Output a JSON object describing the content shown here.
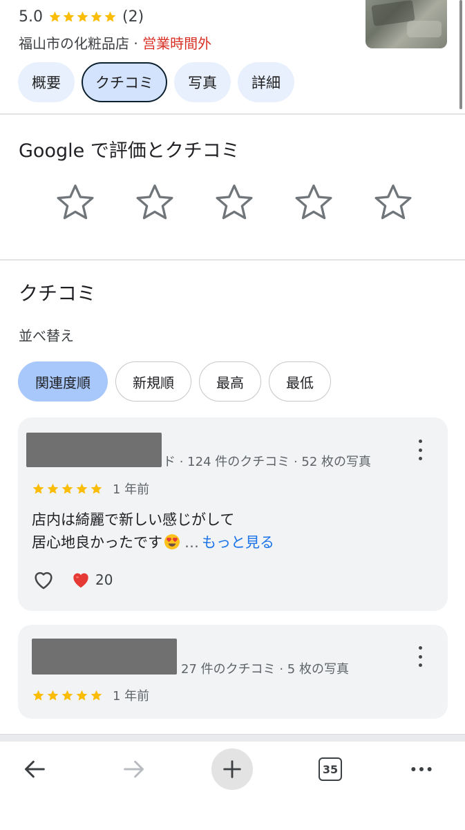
{
  "place": {
    "rating": "5.0",
    "star_count": 5,
    "review_count": "(2)",
    "category": "福山市の化粧品店 · ",
    "status": "営業時間外",
    "colors": {
      "status": "#d93025",
      "star": "#fbbc04"
    }
  },
  "tabs": [
    {
      "label": "概要",
      "active": false
    },
    {
      "label": "クチコミ",
      "active": true
    },
    {
      "label": "写真",
      "active": false
    },
    {
      "label": "詳細",
      "active": false
    }
  ],
  "rate": {
    "title": "Google で評価とクチコミ",
    "stars": 5
  },
  "reviews": {
    "title": "クチコミ",
    "sort_label": "並べ替え",
    "sort_options": [
      {
        "label": "関連度順",
        "active": true
      },
      {
        "label": "新規順",
        "active": false
      },
      {
        "label": "最高",
        "active": false
      },
      {
        "label": "最低",
        "active": false
      }
    ],
    "items": [
      {
        "meta": "ド · 124 件のクチコミ · 52 枚の写真",
        "rating": 5,
        "date": "1 年前",
        "text_line1": "店内は綺麗で新しい感じがして",
        "text_line2": "居心地良かったです",
        "ellipsis": "…",
        "more": "もっと見る",
        "reaction_count": "20"
      },
      {
        "meta": "27 件のクチコミ · 5 枚の写真",
        "rating": 5,
        "date": "1 年前"
      }
    ]
  },
  "toolbar": {
    "tab_count": "35",
    "icons": [
      "back-arrow-icon",
      "forward-arrow-icon",
      "plus-icon",
      "tab-switcher-icon",
      "more-dots-icon"
    ]
  }
}
